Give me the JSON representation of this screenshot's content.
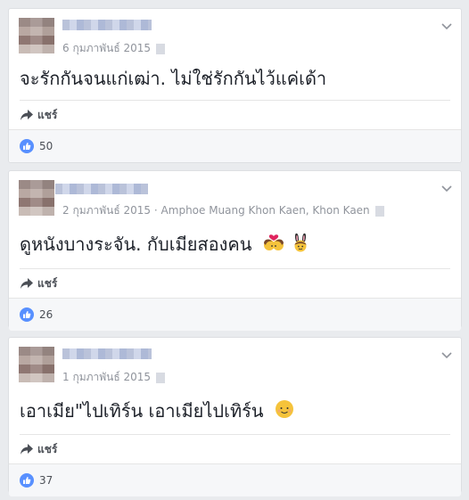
{
  "posts": [
    {
      "date": "6 กุมภาพันธ์ 2015",
      "location": "",
      "text": "จะรักกันจนแก่เฒ่า. ไม่ใช่รักกันไว้แค่เด้า",
      "share_label": "แชร์",
      "likes": "50",
      "emojis": []
    },
    {
      "date": "2 กุมภาพันธ์ 2015",
      "location": "Amphoe Muang Khon Kaen, Khon Kaen",
      "text": "ดูหนังบางระจัน. กับเมียสองคน",
      "share_label": "แชร์",
      "likes": "26",
      "emojis": [
        "couple-kiss-emoji",
        "bunny-ears-emoji"
      ]
    },
    {
      "date": "1 กุมภาพันธ์ 2015",
      "location": "",
      "text": "เอาเมีย\"ไปเทิร์น เอาเมียไปเทิร์น",
      "share_label": "แชร์",
      "likes": "37",
      "emojis": [
        "smiling-face-emoji"
      ]
    }
  ],
  "colors": {
    "like_blue": "#5890ff",
    "meta_gray": "#90949c",
    "text_dark": "#1d2129",
    "feed_bg": "#e9ebee"
  }
}
